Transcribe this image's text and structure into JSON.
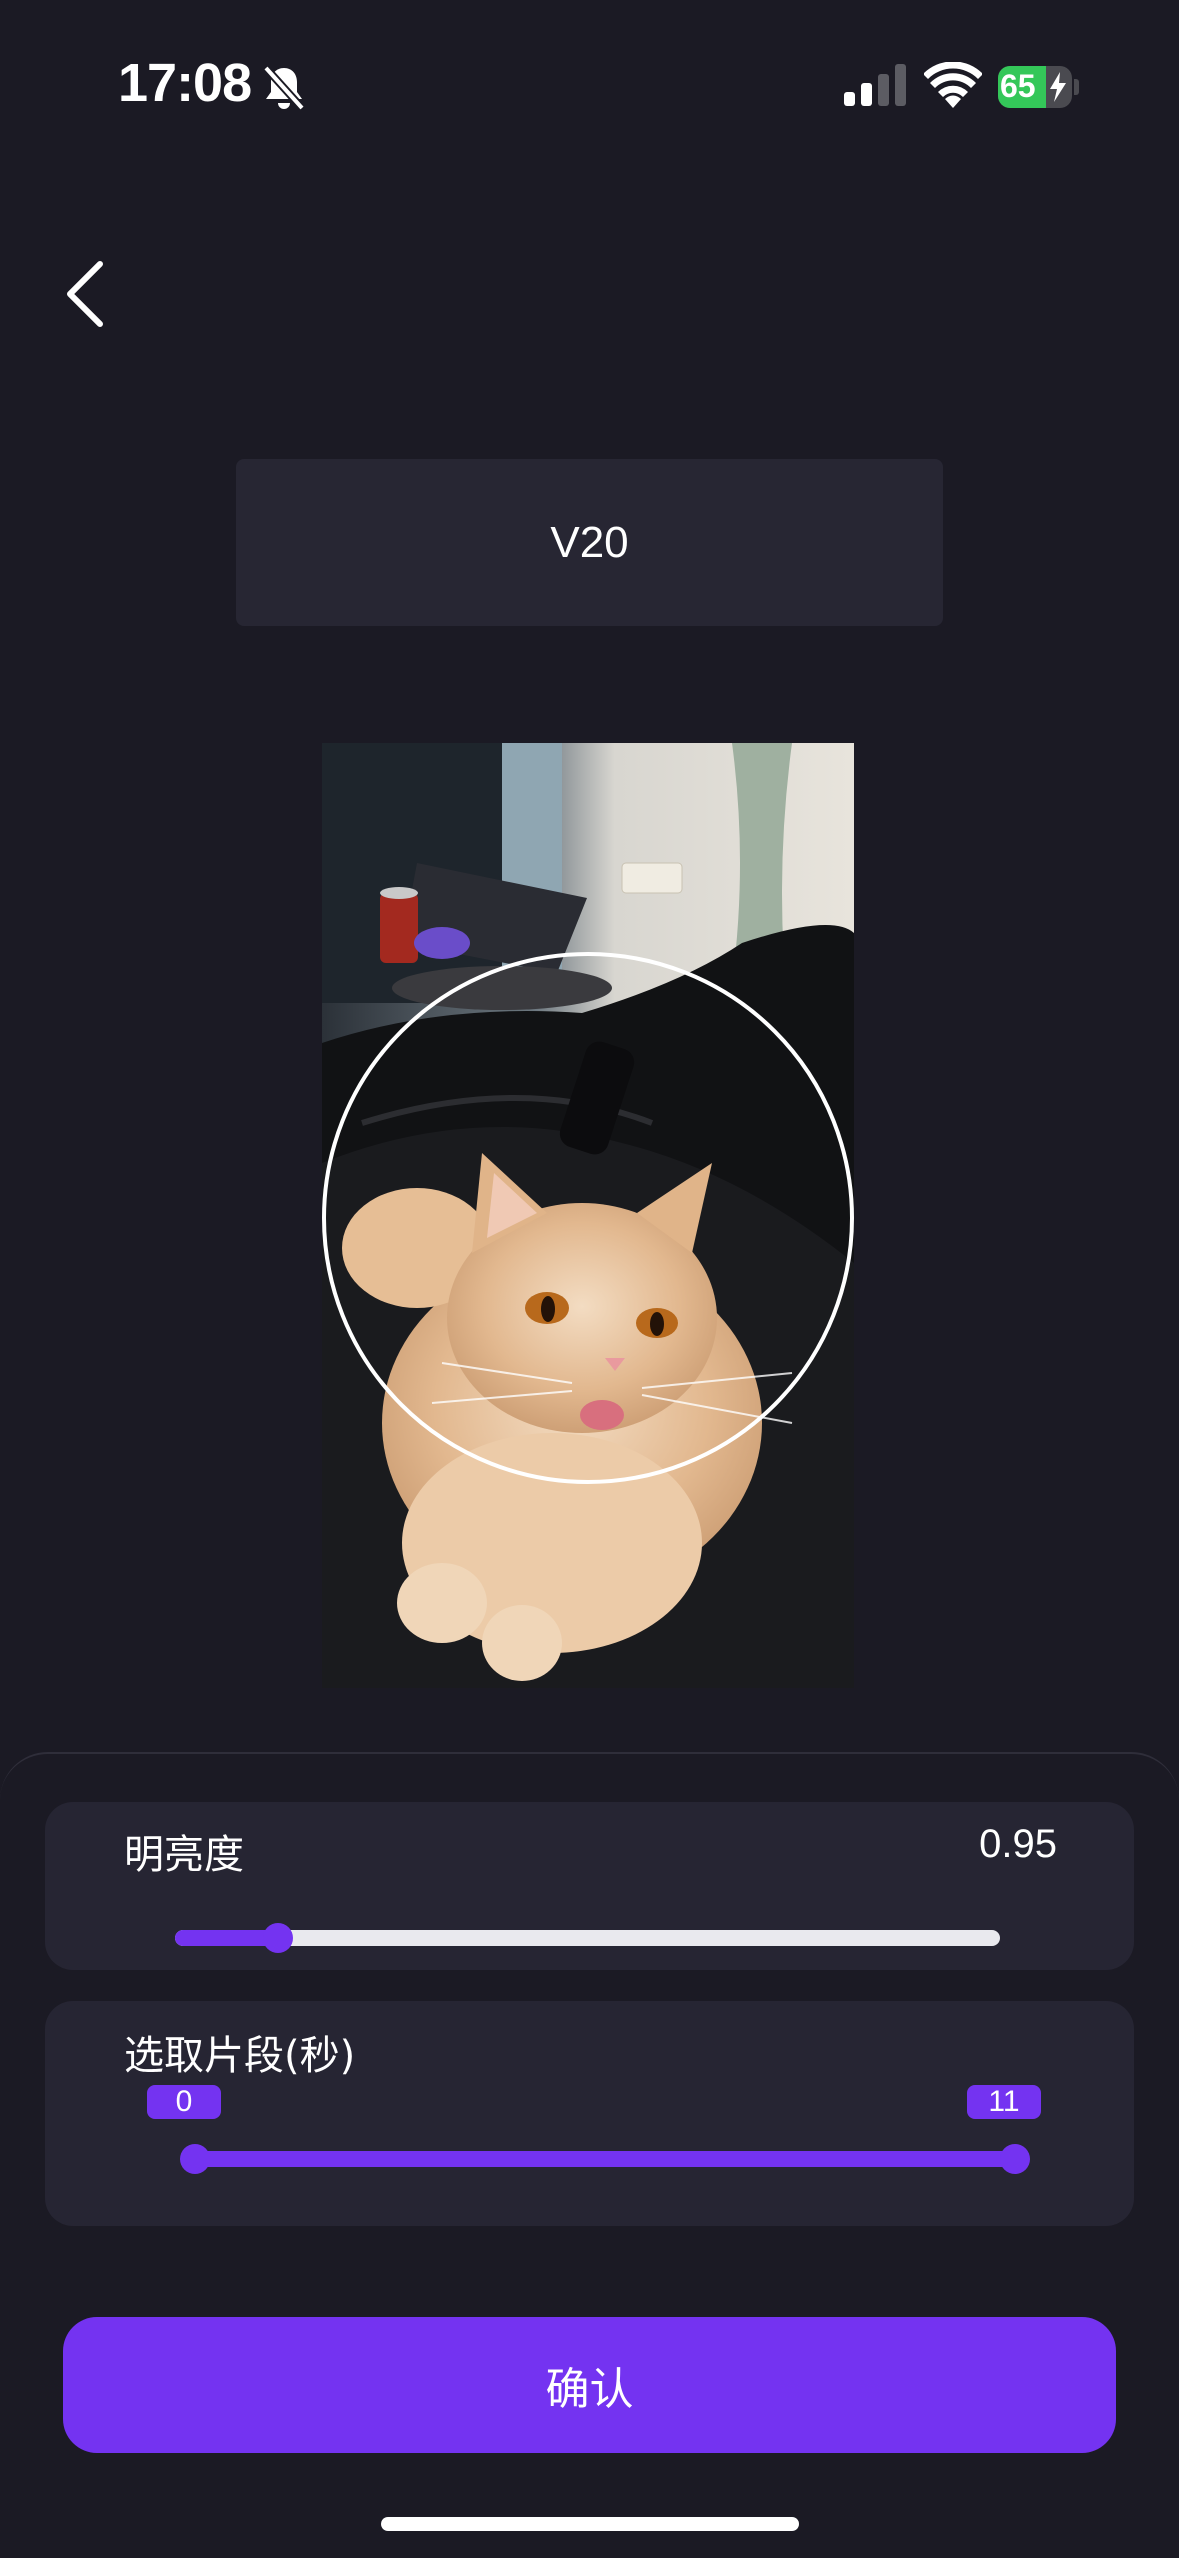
{
  "status_bar": {
    "time": "17:08",
    "battery_percent": "65",
    "battery_level": 0.65,
    "icons": [
      "bell-slash-icon",
      "cellular-signal-icon",
      "wifi-icon",
      "battery-charging-icon"
    ]
  },
  "nav": {
    "back_icon": "chevron-left-icon"
  },
  "header": {
    "title": "V20"
  },
  "preview": {
    "overlay": "circle-frame"
  },
  "brightness": {
    "label": "明亮度",
    "value": "0.95",
    "slider_fraction": 0.125
  },
  "clip": {
    "label": "选取片段(秒)",
    "start": "0",
    "end": "11",
    "start_fraction": 0.0,
    "end_fraction": 1.0
  },
  "actions": {
    "confirm_label": "确认"
  },
  "colors": {
    "accent": "#7433f1",
    "background": "#1b1a24",
    "card": "#262533"
  }
}
